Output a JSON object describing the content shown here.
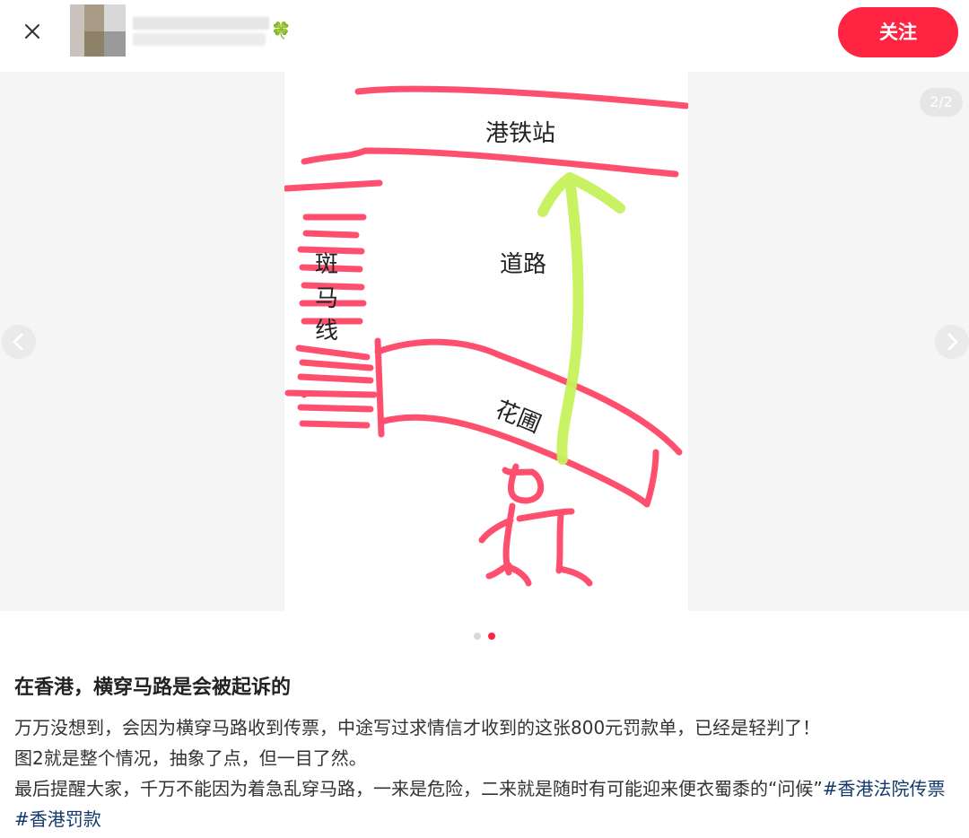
{
  "header": {
    "close_icon": "close-icon",
    "author_badge": "🍀",
    "follow_label": "关注",
    "accent": "#ff2442"
  },
  "carousel": {
    "counter": "2/2",
    "total_slides": 2,
    "active_index": 1,
    "drawing": {
      "label_station": "港铁站",
      "label_road": "道路",
      "label_crossing_1": "斑",
      "label_crossing_2": "马",
      "label_crossing_3": "线",
      "label_garden": "花圃",
      "stroke_red": "#ff4f6f",
      "stroke_green": "#c6f25a"
    }
  },
  "post": {
    "title": "在香港，横穿马路是会被起诉的",
    "line1": "万万没想到，会因为横穿马路收到传票，中途写过求情信才收到的这张800元罚款单，已经是轻判了！",
    "line2": "图2就是整个情况，抽象了点，但一目了然。",
    "line3_text": "最后提醒大家，千万不能因为着急乱穿马路，一来是危险，二来就是随时有可能迎来便衣蜀黍的“问候”",
    "tag1": "#香港法院传票",
    "tag2": "#香港罚款"
  }
}
